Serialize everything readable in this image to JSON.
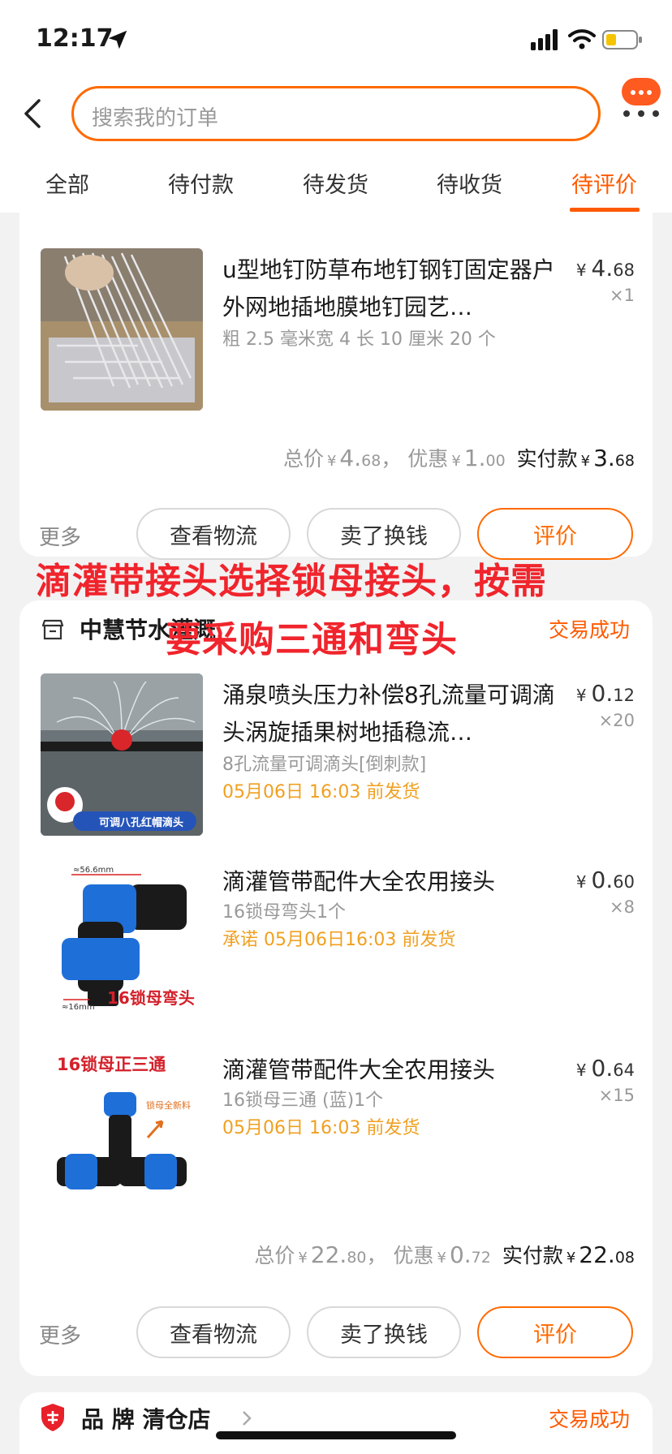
{
  "status_bar": {
    "time": "12:17"
  },
  "search": {
    "placeholder": "搜索我的订单"
  },
  "tabs": [
    {
      "label": "全部"
    },
    {
      "label": "待付款"
    },
    {
      "label": "待发货"
    },
    {
      "label": "待收货"
    },
    {
      "label": "待评价",
      "active": true
    }
  ],
  "orders": [
    {
      "items": [
        {
          "title": "u型地钉防草布地钉钢钉固定器户外网地插地膜地钉园艺…",
          "sku": "粗 2.5 毫米宽 4 长 10 厘米 20 个",
          "price_currency": "¥",
          "price_int": "4.",
          "price_dec": "68",
          "qty": "×1"
        }
      ],
      "totals": {
        "total_label": "总价",
        "total_int": "4.",
        "total_dec": "68",
        "sep": "，",
        "discount_label": "优惠",
        "discount_int": "1.",
        "discount_dec": "00",
        "paid_label": "实付款",
        "paid_int": "3.",
        "paid_dec": "68",
        "currency": "¥"
      },
      "actions": {
        "more": "更多",
        "logistics": "查看物流",
        "resell": "卖了换钱",
        "review": "评价"
      }
    },
    {
      "shop_name": "中慧节水灌溉",
      "status": "交易成功",
      "items": [
        {
          "title": "涌泉喷头压力补偿8孔流量可调滴头涡旋插果树地插稳流…",
          "sku": "8孔流量可调滴头[倒刺款]",
          "ship": "05月06日 16:03 前发货",
          "price_currency": "¥",
          "price_int": "0.",
          "price_dec": "12",
          "qty": "×20",
          "thumb_caption": "可调八孔红帽滴头"
        },
        {
          "title": "滴灌管带配件大全农用接头",
          "sku": "16锁母弯头1个",
          "ship": "承诺 05月06日16:03 前发货",
          "price_currency": "¥",
          "price_int": "0.",
          "price_dec": "60",
          "qty": "×8",
          "thumb_caption": "16锁母弯头",
          "thumb_dim_top": "≈56.6mm",
          "thumb_dim_bottom": "≈16mm"
        },
        {
          "title": "滴灌管带配件大全农用接头",
          "sku": "16锁母三通 (蓝)1个",
          "ship": "05月06日 16:03 前发货",
          "price_currency": "¥",
          "price_int": "0.",
          "price_dec": "64",
          "qty": "×15",
          "thumb_caption": "16锁母正三通",
          "thumb_note": "锁母全新料"
        }
      ],
      "totals": {
        "total_label": "总价",
        "total_int": "22.",
        "total_dec": "80",
        "sep": "，",
        "discount_label": "优惠",
        "discount_int": "0.",
        "discount_dec": "72",
        "paid_label": "实付款",
        "paid_int": "22.",
        "paid_dec": "08",
        "currency": "¥"
      },
      "actions": {
        "more": "更多",
        "logistics": "查看物流",
        "resell": "卖了换钱",
        "review": "评价"
      }
    },
    {
      "shop_name": "品 牌 清仓店",
      "status": "交易成功"
    }
  ],
  "overlay": {
    "line1": "滴灌带接头选择锁母接头，按需",
    "line2": "要采购三通和弯头"
  },
  "colors": {
    "accent": "#ff5a00",
    "ship": "#f0a020",
    "overlay": "#f0242c"
  }
}
